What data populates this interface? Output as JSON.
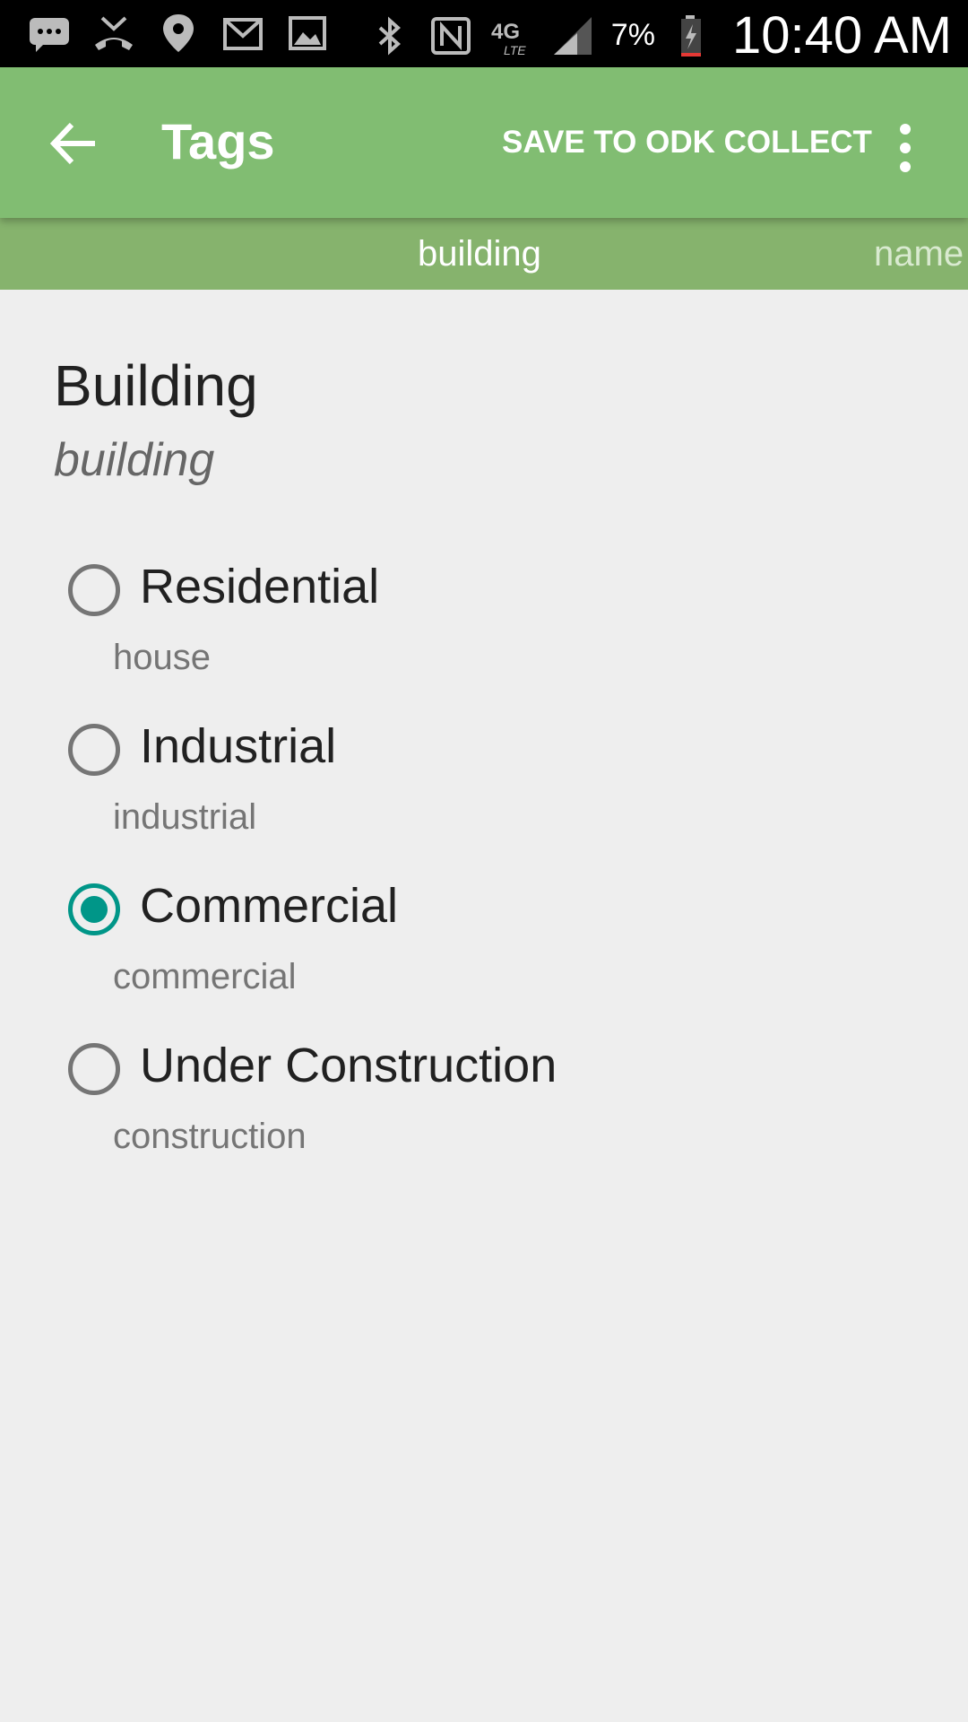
{
  "status_bar": {
    "left_icons": [
      "message-icon",
      "missed-call-icon",
      "location-icon",
      "gmail-icon",
      "image-icon"
    ],
    "right_icons": [
      "bluetooth-icon",
      "nfc-icon",
      "4g-lte-icon",
      "signal-icon",
      "battery-charging-icon"
    ],
    "battery_percent": "7%",
    "time": "10:40 AM"
  },
  "app_bar": {
    "back_icon": "arrow-back-icon",
    "title": "Tags",
    "save_label": "SAVE TO ODK COLLECT",
    "overflow_icon": "more-vert-icon",
    "color": "#81bd72"
  },
  "tabs": {
    "active": "building",
    "next": "name"
  },
  "question": {
    "title": "Building",
    "key": "building"
  },
  "options": [
    {
      "label": "Residential",
      "value": "house",
      "checked": false
    },
    {
      "label": "Industrial",
      "value": "industrial",
      "checked": false
    },
    {
      "label": "Commercial",
      "value": "commercial",
      "checked": true
    },
    {
      "label": "Under Construction",
      "value": "construction",
      "checked": false
    }
  ],
  "colors": {
    "accent": "#009688",
    "background": "#eeeeee",
    "tabstrip": "#86b36d"
  }
}
